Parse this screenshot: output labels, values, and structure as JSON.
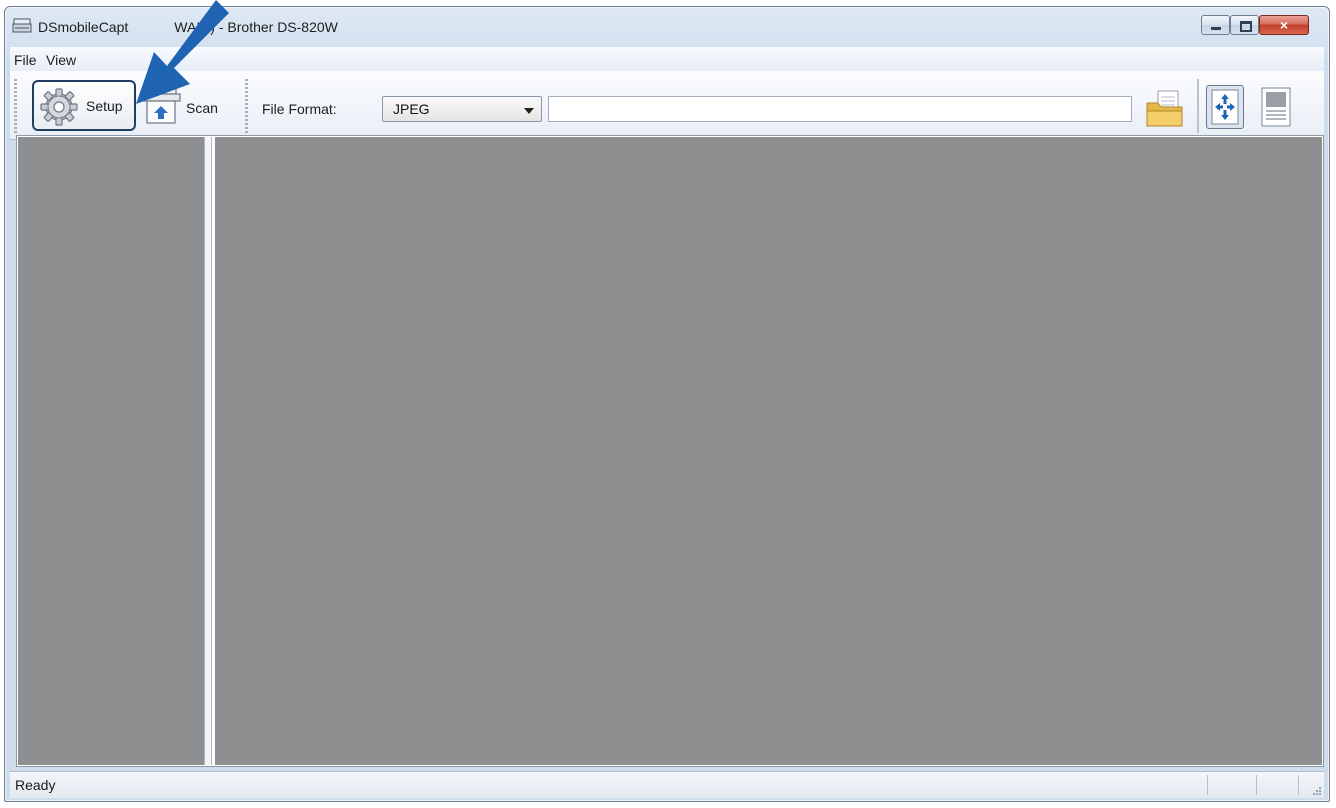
{
  "window": {
    "title": "DSmobileCapture (TWAIN) - Brother DS-820W",
    "title_visible": "DSmobileCapt",
    "title_visible_after_arrow": "WAIN) - Brother DS-820W",
    "icon": "scanner-icon"
  },
  "window_controls": {
    "minimize_icon": "minimize-icon",
    "maximize_icon": "maximize-icon",
    "close_label": "×"
  },
  "menu": {
    "items": [
      {
        "label": "File"
      },
      {
        "label": "View"
      }
    ]
  },
  "toolbar": {
    "setup_label": "Setup",
    "setup_icon": "gear-icon",
    "scan_label": "Scan",
    "scan_icon": "scanner-icon",
    "file_format_label": "File Format:",
    "file_format_value": "JPEG",
    "file_path_value": "",
    "browse_icon": "folder-icon",
    "fit_view_icon": "fit-to-window-icon",
    "page_view_icon": "page-icon"
  },
  "status": {
    "text": "Ready"
  },
  "annotation": {
    "icon": "pointer-arrow-icon",
    "color": "#1f63b3"
  },
  "colors": {
    "pane_background": "#8d8f91",
    "highlight_border": "#223d63"
  }
}
